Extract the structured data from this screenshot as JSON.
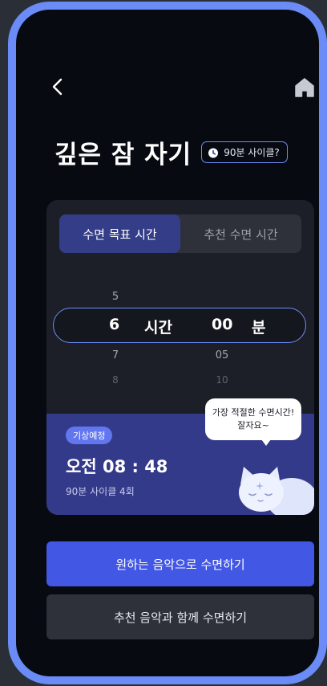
{
  "header": {
    "back_icon": "chevron-left-icon",
    "home_icon": "home-icon"
  },
  "title": "깊은 잠 자기",
  "cycle_chip": {
    "icon": "moon-clock-icon",
    "label": "90분 사이클?"
  },
  "tabs": [
    {
      "label": "수면 목표 시간",
      "active": true
    },
    {
      "label": "추천 수면 시간",
      "active": false
    }
  ],
  "picker": {
    "hours": {
      "above": "5",
      "selected": "6",
      "below": "7",
      "below2": "8",
      "unit": "시간"
    },
    "minutes": {
      "selected": "00",
      "below": "05",
      "below2": "10",
      "unit": "분"
    }
  },
  "wake": {
    "badge": "기상예정",
    "time": "오전 08 : 48",
    "cycle": "90분 사이클 4회"
  },
  "bubble": {
    "line1": "가장 적절한 수면시간!",
    "line2": "잘자요~"
  },
  "buttons": {
    "primary": "원하는 음악으로 수면하기",
    "secondary": "추천 음악과 함께 수면하기"
  },
  "colors": {
    "accent": "#6b8cf6",
    "primary_button": "#4257e3",
    "panel": "#343a8a",
    "background": "#070a11"
  }
}
